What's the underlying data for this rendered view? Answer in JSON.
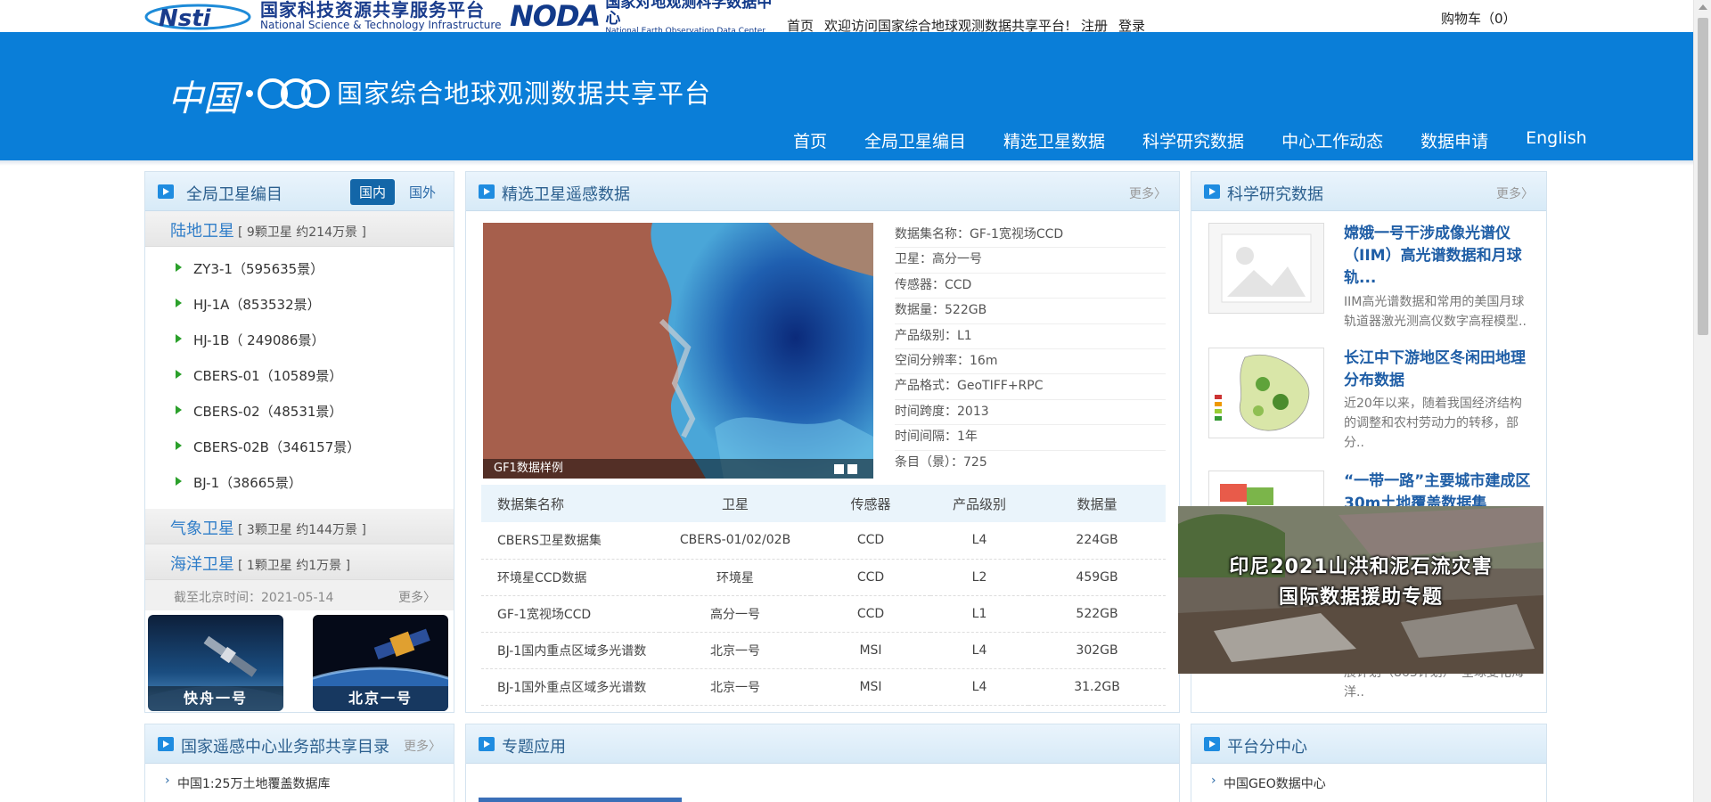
{
  "topbar": {
    "nsti_cn": "国家科技资源共享服务平台",
    "nsti_en": "National Science & Technology Infrastructure",
    "noda_mark": "NODA",
    "noda_cn": "国家对地观测科学数据中心",
    "noda_en": "National Earth Observation Data Center",
    "links": [
      "首页",
      "欢迎访问国家综合地球观测数据共享平台!",
      "注册",
      "登录"
    ],
    "cart": "购物车（0）"
  },
  "banner": {
    "logo_cn": "中国",
    "title": "国家综合地球观测数据共享平台",
    "nav": [
      "首页",
      "全局卫星编目",
      "精选卫星数据",
      "科学研究数据",
      "中心工作动态",
      "数据申请",
      "English"
    ]
  },
  "left_panel": {
    "title": "全局卫星编目",
    "tabs": [
      "国内",
      "国外"
    ],
    "categories": [
      {
        "name": "陆地卫星",
        "info": "[ 9颗卫星 约214万景 ]"
      },
      {
        "name": "气象卫星",
        "info": "[ 3颗卫星 约144万景 ]"
      },
      {
        "name": "海洋卫星",
        "info": "[ 1颗卫星 约1万景 ]"
      }
    ],
    "satellites": [
      "ZY3-1（595635景）",
      "HJ-1A（853532景）",
      "HJ-1B（ 249086景）",
      "CBERS-01（10589景）",
      "CBERS-02（48531景）",
      "CBERS-02B（346157景）",
      "BJ-1（38665景）"
    ],
    "date_text": "截至北京时间：2021-05-14",
    "more": "更多〉",
    "cards": [
      "快舟一号",
      "北京一号"
    ]
  },
  "middle_panel": {
    "title": "精选卫星遥感数据",
    "more": "更多〉",
    "image_caption": "GF1数据样例",
    "meta": [
      {
        "k": "数据集名称：",
        "v": "GF-1宽视场CCD"
      },
      {
        "k": "卫星：",
        "v": "高分一号"
      },
      {
        "k": "传感器：",
        "v": "CCD"
      },
      {
        "k": "数据量：",
        "v": "522GB"
      },
      {
        "k": "产品级别：",
        "v": "L1"
      },
      {
        "k": "空间分辨率：",
        "v": "16m"
      },
      {
        "k": "产品格式：",
        "v": "GeoTIFF+RPC"
      },
      {
        "k": "时间跨度：",
        "v": "2013"
      },
      {
        "k": "时间间隔：",
        "v": "1年"
      },
      {
        "k": "条目（景）：",
        "v": "725"
      }
    ],
    "table": {
      "headers": [
        "数据集名称",
        "卫星",
        "传感器",
        "产品级别",
        "数据量"
      ],
      "rows": [
        [
          "CBERS卫星数据集",
          "CBERS-01/02/02B",
          "CCD",
          "L4",
          "224GB"
        ],
        [
          "环境星CCD数据",
          "环境星",
          "CCD",
          "L2",
          "459GB"
        ],
        [
          "GF-1宽视场CCD",
          "高分一号",
          "CCD",
          "L1",
          "522GB"
        ],
        [
          "BJ-1国内重点区域多光谱数",
          "北京一号",
          "MSI",
          "L4",
          "302GB"
        ],
        [
          "BJ-1国外重点区域多光谱数",
          "北京一号",
          "MSI",
          "L4",
          "31.2GB"
        ]
      ]
    }
  },
  "right_panel": {
    "title": "科学研究数据",
    "more": "更多〉",
    "news": [
      {
        "title": "嫦娥一号干涉成像光谱仪（IIM）高光谱数据和月球轨...",
        "desc": "IIM高光谱数据和常用的美国月球轨道器激光测高仪数字高程模型.."
      },
      {
        "title": "长江中下游地区冬闲田地理分布数据",
        "desc": "近20年以来，随着我国经济结构的调整和农村劳动力的转移，部分.."
      },
      {
        "title": "“一带一路”主要城市建成区30m土地覆盖数据集",
        "desc": "展计划（863计划）“全球变化海洋.."
      }
    ],
    "popup_title": "印尼2021山洪和泥石流灾害国际数据援助专题"
  },
  "bottom": {
    "panel1_title": "国家遥感中心业务部共享目录",
    "panel1_more": "更多〉",
    "panel1_item": "中国1:25万土地覆盖数据库",
    "panel2_title": "专题应用",
    "panel3_title": "平台分中心",
    "panel3_item": "中国GEO数据中心"
  },
  "colors": {
    "banner": "#0a7ed8",
    "link_blue": "#1f5ea6",
    "accent_green": "#2ba02b"
  }
}
